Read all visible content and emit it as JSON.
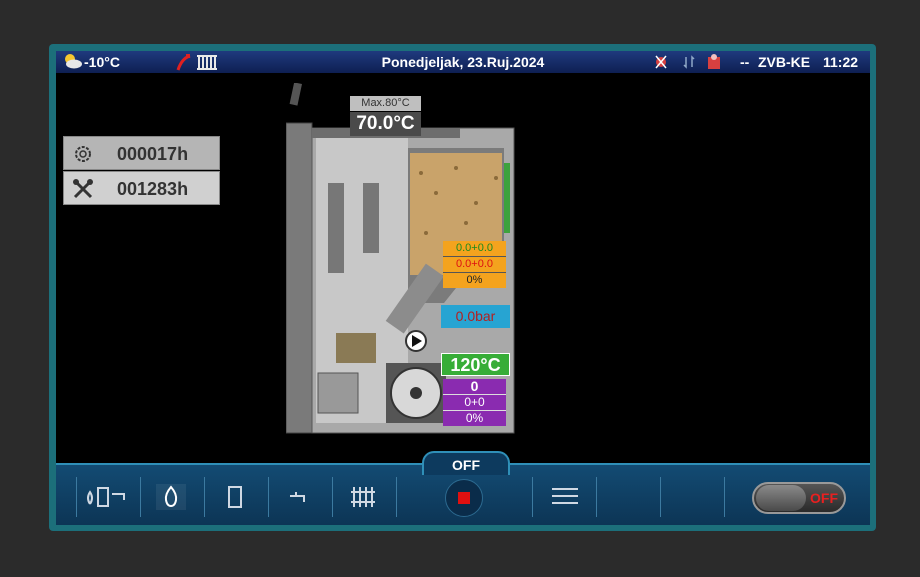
{
  "status_bar": {
    "weather_icon": "partly-cloudy-icon",
    "outside_temp": "-10°C",
    "chimney_icon": "chimney-radiator-icon",
    "date": "Ponedjeljak, 23.Ruj.2024",
    "alert_icons": [
      "fan-alert-icon",
      "transfer-arrows-icon",
      "user-alert-icon"
    ],
    "dash": "--",
    "device_id": "ZVB-KE",
    "time": "11:22"
  },
  "counters": [
    {
      "icon": "gear-icon",
      "value": "000017h"
    },
    {
      "icon": "tools-icon",
      "value": "001283h"
    }
  ],
  "boiler": {
    "max_temp_label": "Max.80°C",
    "current_temp": "70.0°C",
    "pellet_feed": [
      "0.0+0.0",
      "0.0+0.0",
      "0%"
    ],
    "pressure": "0.0bar",
    "water_temp": "120°C",
    "fan": [
      "0",
      "0+0",
      "0%"
    ]
  },
  "bottom_bar": {
    "status_tab": "OFF",
    "nav_items": [
      {
        "name": "nav-boiler-overview",
        "icon": "boiler-overview-icon"
      },
      {
        "name": "nav-flame",
        "icon": "flame-icon",
        "active": true
      },
      {
        "name": "nav-boiler",
        "icon": "boiler-icon"
      },
      {
        "name": "nav-tap",
        "icon": "water-tap-icon"
      },
      {
        "name": "nav-heating",
        "icon": "radiator-icon"
      }
    ],
    "stop_button_icon": "stop-icon",
    "menu_icon": "hamburger-menu-icon",
    "power_toggle_label": "OFF"
  },
  "colors": {
    "status_bar": "#1f3a7e",
    "frame": "#1c6f7a",
    "pellet_box": "#f4a31e",
    "pressure_box": "#27a4d2",
    "water_temp_box": "#37ad37",
    "fan_box": "#8a2bb0",
    "stop_red": "#e01010"
  }
}
